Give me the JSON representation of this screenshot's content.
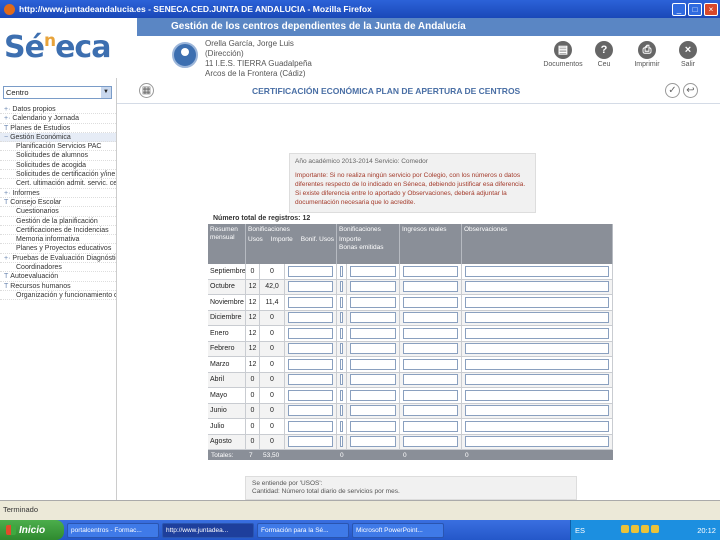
{
  "window": {
    "title": "http://www.juntadeandalucia.es - SENECA.CED.JUNTA DE ANDALUCIA - Mozilla Firefox"
  },
  "header": {
    "banner": "Gestión de los centros dependientes de la Junta de Andalucía",
    "logo_main": "Sé",
    "logo_sup": "n",
    "logo_rest": "eca",
    "user": [
      "Orella García, Jorge Luis",
      "(Dirección)",
      "11 I.E.S. TIERRA Guadalpeña",
      "Arcos de la Frontera (Cádiz)"
    ],
    "tools": {
      "docs": "Documentos",
      "help": "Ceu",
      "print": "Imprimir",
      "exit": "Salir"
    }
  },
  "sidebar": {
    "select_value": "Centro",
    "items": [
      {
        "label": "Datos propios",
        "mk": "+"
      },
      {
        "label": "Calendario y Jornada",
        "mk": "+"
      },
      {
        "label": "Planes de Estudios",
        "mk": "T"
      },
      {
        "label": "Gestión Económica",
        "mk": "-"
      },
      {
        "label": "Planificación Servicios PAC",
        "mk": ""
      },
      {
        "label": "Solicitudes de alumnos",
        "mk": ""
      },
      {
        "label": "Solicitudes de acogida",
        "mk": ""
      },
      {
        "label": "Solicitudes de certificación y/ine",
        "mk": ""
      },
      {
        "label": "Cert. ultimación admit. servic. certi",
        "mk": ""
      },
      {
        "label": "Informes",
        "mk": "+"
      },
      {
        "label": "Consejo Escolar",
        "mk": "T"
      },
      {
        "label": "Cuestionarios",
        "mk": ""
      },
      {
        "label": "Gestión de la planificación",
        "mk": ""
      },
      {
        "label": "Certificaciones de Incidencias",
        "mk": ""
      },
      {
        "label": "Memoria informativa",
        "mk": ""
      },
      {
        "label": "Planes y Proyectos educativos",
        "mk": ""
      },
      {
        "label": "Pruebas de Evaluación Diagnóstica",
        "mk": "+"
      },
      {
        "label": "Coordinadores",
        "mk": ""
      },
      {
        "label": "Autoevaluación",
        "mk": "T"
      },
      {
        "label": "Recursos humanos",
        "mk": "T"
      },
      {
        "label": "Organización y funcionamiento del B",
        "mk": ""
      }
    ]
  },
  "main": {
    "title": "CERTIFICACIÓN ECONÓMICA PLAN DE APERTURA DE CENTROS",
    "info_line": "Año académico 2013-2014   Servicio: Comedor",
    "note": "Importante: Si no realiza ningún servicio por Colegio, con los números o datos diferentes respecto de lo indicado en Séneca, debiendo justificar esa diferencia. Si existe diferencia entre lo aportado y Observaciones, deberá adjuntar la documentación necesaria que lo acredite.",
    "reg_total": "Número total de registros: 12",
    "columns": {
      "mes": "Resumen mensual",
      "bon1": "Bonificaciones",
      "usos1": "Usos",
      "imp1": "Importe",
      "bonas": "Bonif. Usos",
      "bon2": "Bonificaciones",
      "imp2": "Importe",
      "bonem": "Bonas emitidas",
      "ing": "Ingresos reales",
      "obs": "Observaciones"
    },
    "rows": [
      {
        "mes": "Septiembre",
        "usos": "0",
        "imp": "0"
      },
      {
        "mes": "Octubre",
        "usos": "12",
        "imp": "42,0"
      },
      {
        "mes": "Noviembre",
        "usos": "12",
        "imp": "11,4"
      },
      {
        "mes": "Diciembre",
        "usos": "12",
        "imp": "0"
      },
      {
        "mes": "Enero",
        "usos": "12",
        "imp": "0"
      },
      {
        "mes": "Febrero",
        "usos": "12",
        "imp": "0"
      },
      {
        "mes": "Marzo",
        "usos": "12",
        "imp": "0"
      },
      {
        "mes": "Abril",
        "usos": "0",
        "imp": "0"
      },
      {
        "mes": "Mayo",
        "usos": "0",
        "imp": "0"
      },
      {
        "mes": "Junio",
        "usos": "0",
        "imp": "0"
      },
      {
        "mes": "Julio",
        "usos": "0",
        "imp": "0"
      },
      {
        "mes": "Agosto",
        "usos": "0",
        "imp": "0"
      }
    ],
    "totals": {
      "label": "Totales:",
      "usos": "7",
      "imp": "53,50",
      "b2": "0",
      "imp2": "0",
      "ing": "0"
    },
    "lower": [
      "Se entiende por 'USOS':",
      "Cantidad: Número total diario de servicios por mes."
    ]
  },
  "status": {
    "text": "Terminado"
  },
  "taskbar": {
    "start": "Inicio",
    "tasks": [
      "portalcentros - Formac...",
      "http://www.juntadea...",
      "Formación para la Sé...",
      "Microsoft PowerPoint..."
    ],
    "lang": "ES",
    "clock": "20:12"
  }
}
